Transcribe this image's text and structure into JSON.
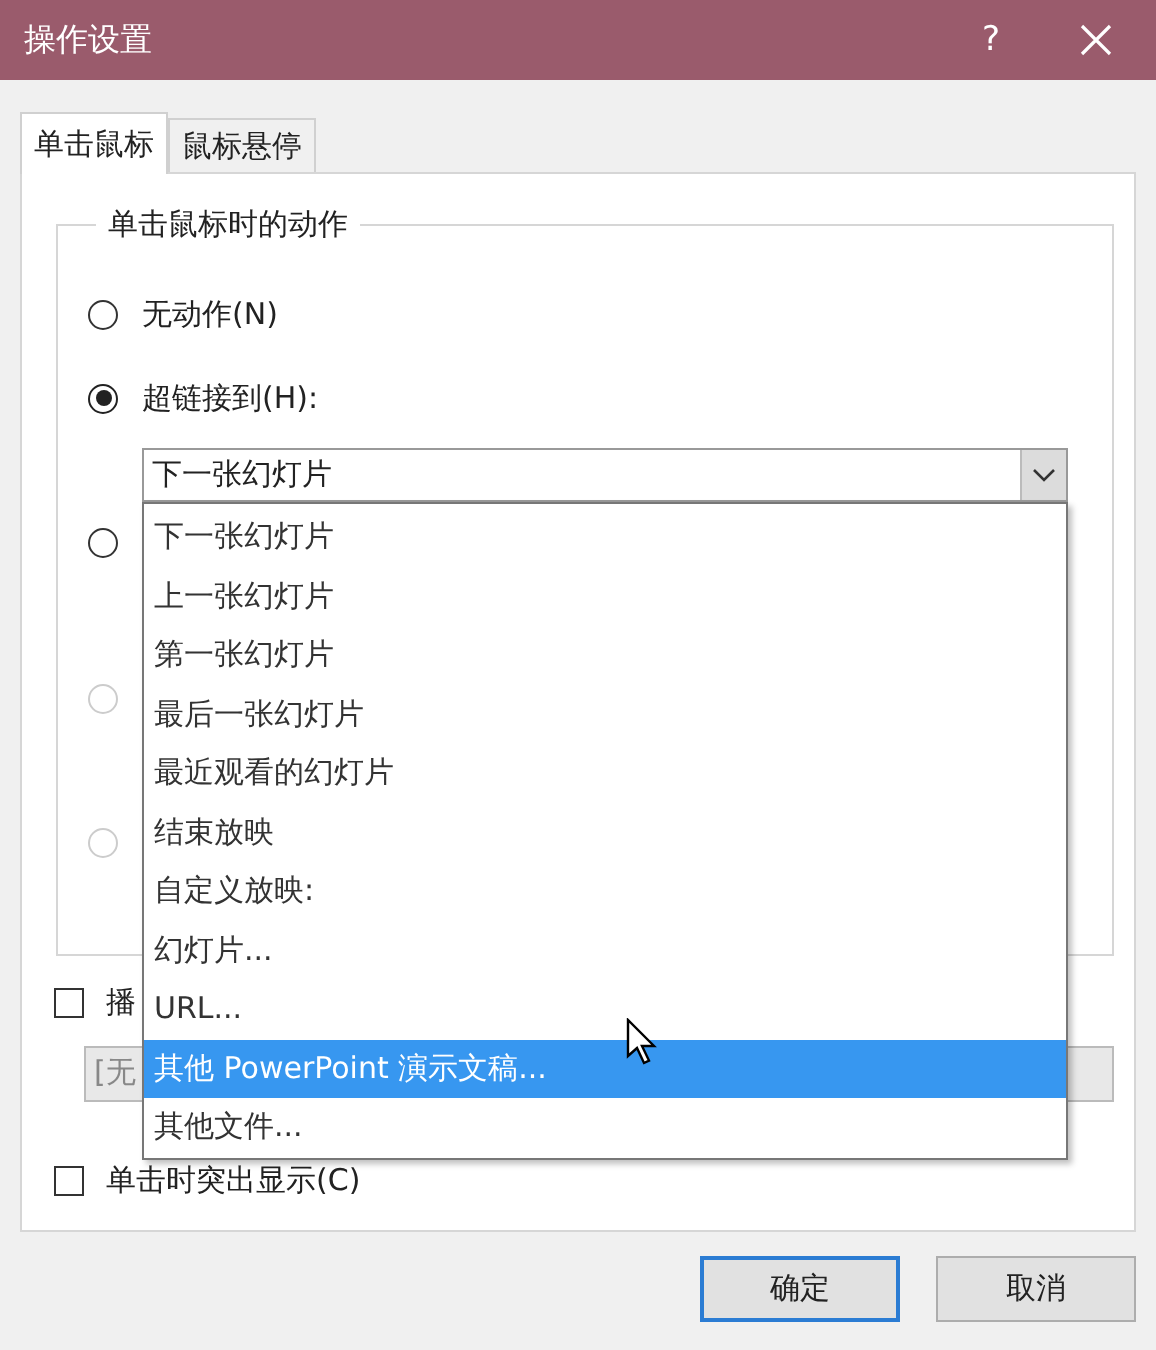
{
  "window": {
    "title": "操作设置",
    "help": "?"
  },
  "tabs": [
    {
      "label": "单击鼠标",
      "selected": true
    },
    {
      "label": "鼠标悬停",
      "selected": false
    }
  ],
  "group": {
    "legend": "单击鼠标时的动作",
    "options": [
      {
        "label": "无动作(N)",
        "selected": false,
        "disabled": false
      },
      {
        "label": "超链接到(H):",
        "selected": true,
        "disabled": false,
        "combo": {
          "value": "下一张幻灯片",
          "expanded": true
        }
      },
      {
        "selected": false,
        "disabled": false
      },
      {
        "selected": false,
        "disabled": true
      },
      {
        "selected": false,
        "disabled": true
      }
    ]
  },
  "dropdown": {
    "items": [
      {
        "label": "下一张幻灯片",
        "selected": false
      },
      {
        "label": "上一张幻灯片",
        "selected": false
      },
      {
        "label": "第一张幻灯片",
        "selected": false
      },
      {
        "label": "最后一张幻灯片",
        "selected": false
      },
      {
        "label": "最近观看的幻灯片",
        "selected": false
      },
      {
        "label": "结束放映",
        "selected": false
      },
      {
        "label": "自定义放映:",
        "selected": false
      },
      {
        "label": "幻灯片...",
        "selected": false
      },
      {
        "label": "URL...",
        "selected": false
      },
      {
        "label": "其他 PowerPoint 演示文稿...",
        "selected": true
      },
      {
        "label": "其他文件...",
        "selected": false
      }
    ]
  },
  "sound": {
    "label": "播",
    "checked": false,
    "select": {
      "value": "[无",
      "disabled": true
    }
  },
  "highlight": {
    "label": "单击时突出显示(C)",
    "checked": false
  },
  "buttons": [
    {
      "label": "确定",
      "default": true
    },
    {
      "label": "取消",
      "default": false
    }
  ]
}
